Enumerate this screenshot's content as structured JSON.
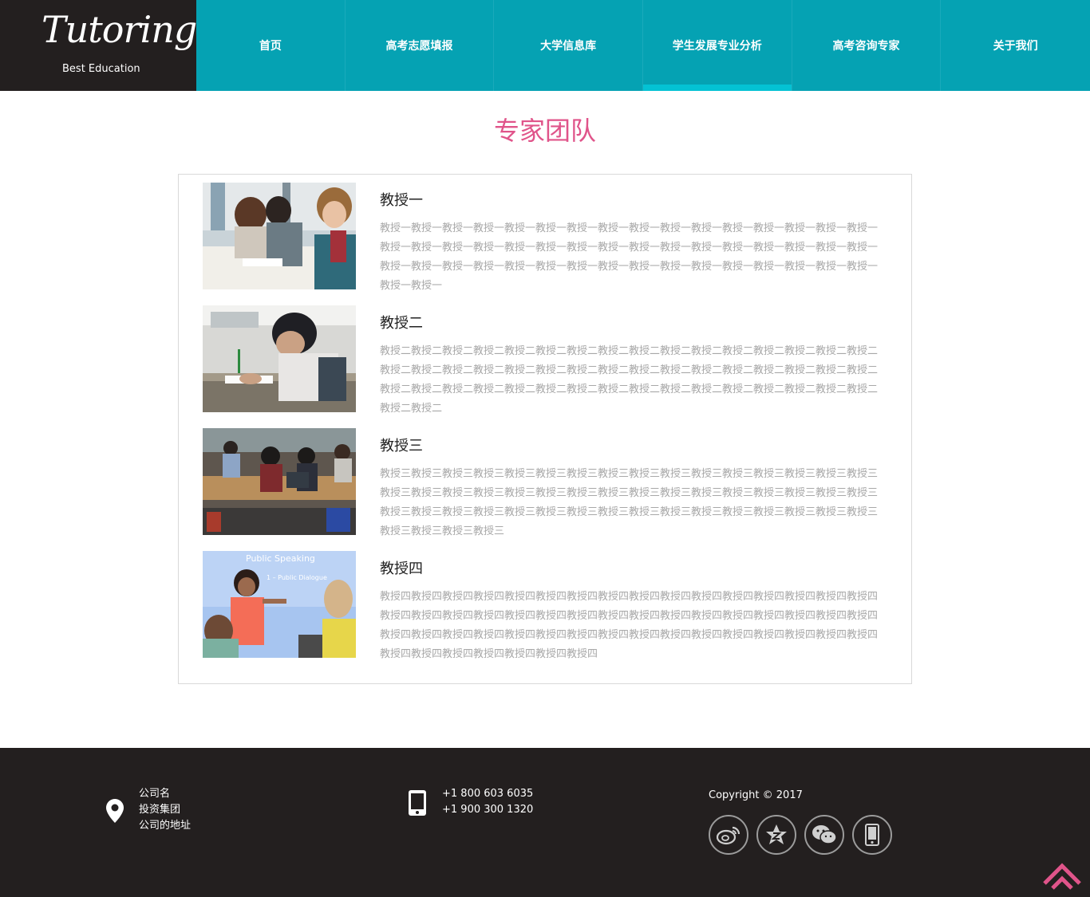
{
  "logo": {
    "script": "Tutoring",
    "tagline": "Best Education"
  },
  "nav": {
    "items": [
      "首页",
      "高考志愿填报",
      "大学信息库",
      "学生发展专业分析",
      "高考咨询专家",
      "关于我们"
    ],
    "active_index": 3
  },
  "page_title": "专家团队",
  "professors": [
    {
      "name": "教授一",
      "desc": "教授一教授一教授一教授一教授一教授一教授一教授一教授一教授一教授一教授一教授一教授一教授一教授一教授一教授一教授一教授一教授一教授一教授一教授一教授一教授一教授一教授一教授一教授一教授一教授一教授一教授一教授一教授一教授一教授一教授一教授一教授一教授一教授一教授一教授一教授一教授一教授一教授一教授一",
      "photo": "students-studying-photo"
    },
    {
      "name": "教授二",
      "desc": "教授二教授二教授二教授二教授二教授二教授二教授二教授二教授二教授二教授二教授二教授二教授二教授二教授二教授二教授二教授二教授二教授二教授二教授二教授二教授二教授二教授二教授二教授二教授二教授二教授二教授二教授二教授二教授二教授二教授二教授二教授二教授二教授二教授二教授二教授二教授二教授二教授二教授二",
      "photo": "boy-writing-photo"
    },
    {
      "name": "教授三",
      "desc": "教授三教授三教授三教授三教授三教授三教授三教授三教授三教授三教授三教授三教授三教授三教授三教授三教授三教授三教授三教授三教授三教授三教授三教授三教授三教授三教授三教授三教授三教授三教授三教授三教授三教授三教授三教授三教授三教授三教授三教授三教授三教授三教授三教授三教授三教授三教授三教授三教授三教授三教授三教授三",
      "photo": "classroom-laptops-photo"
    },
    {
      "name": "教授四",
      "desc": "教授四教授四教授四教授四教授四教授四教授四教授四教授四教授四教授四教授四教授四教授四教授四教授四教授四教授四教授四教授四教授四教授四教授四教授四教授四教授四教授四教授四教授四教授四教授四教授四教授四教授四教授四教授四教授四教授四教授四教授四教授四教授四教授四教授四教授四教授四教授四教授四教授四教授四教授四教授四教授四教授四教授四",
      "photo": "public-speaking-photo",
      "slide_title": "Public Speaking",
      "slide_subtitle": "1 – Public Dialogue"
    }
  ],
  "footer": {
    "company_name": "公司名",
    "company_group": "投资集团",
    "company_address": "公司的地址",
    "phone1": "+1 800 603 6035",
    "phone2": "+1 900 300 1320",
    "copyright": "Copyright © 2017",
    "socials": [
      "weibo-icon",
      "qzone-icon",
      "wechat-icon",
      "mobile-icon"
    ]
  },
  "colors": {
    "nav_bg": "#05a2b3",
    "active_bar": "#04c2d4",
    "title": "#e0548a",
    "footer_bg": "#231f1f",
    "back_top": "#e0548a"
  }
}
